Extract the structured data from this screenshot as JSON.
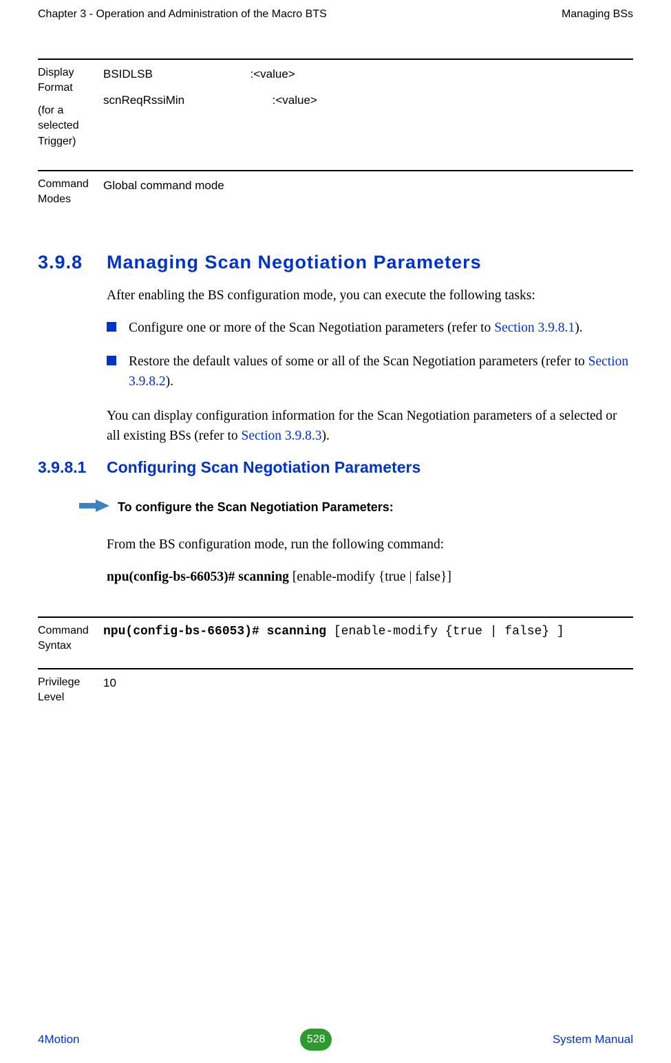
{
  "header": {
    "left": "Chapter 3 - Operation and Administration of the Macro BTS",
    "right": "Managing BSs"
  },
  "display_format_block": {
    "left_1": "Display Format",
    "left_2": "(for a selected Trigger)",
    "line1": "BSIDLSB                              :<value>",
    "line2": "scnReqRssiMin                           :<value>"
  },
  "command_modes_block": {
    "left": "Command Modes",
    "right": "Global command mode"
  },
  "section_398": {
    "num": "3.9.8",
    "title": "Managing Scan Negotiation Parameters",
    "intro": "After enabling the BS configuration mode, you can execute the following tasks:",
    "bullet1_pre": "Configure one or more of the Scan Negotiation parameters (refer to ",
    "bullet1_link": "Section 3.9.8.1",
    "bullet1_post": ").",
    "bullet2_pre": "Restore the default values of some or all of the Scan Negotiation parameters (refer to ",
    "bullet2_link": "Section 3.9.8.2",
    "bullet2_post": ").",
    "outro_pre": "You can display configuration information for the Scan Negotiation parameters of a selected or all existing BSs (refer to ",
    "outro_link": "Section 3.9.8.3",
    "outro_post": ")."
  },
  "section_3981": {
    "num": "3.9.8.1",
    "title": "Configuring Scan Negotiation Parameters",
    "proc_title": "To configure the Scan Negotiation Parameters:",
    "proc_body_1": "From the BS configuration mode, run the following command:",
    "proc_body_2a": "npu(config-bs-66053)# scanning",
    "proc_body_2b": " [enable-modify {true | false}]"
  },
  "command_syntax_block": {
    "left": "Command Syntax",
    "bold": "npu(config-bs-66053)# scanning ",
    "rest": "[enable-modify {true | false} ]"
  },
  "privilege_block": {
    "left": "Privilege Level",
    "right": "10"
  },
  "footer": {
    "left": "4Motion",
    "page": "528",
    "right": "System Manual"
  }
}
